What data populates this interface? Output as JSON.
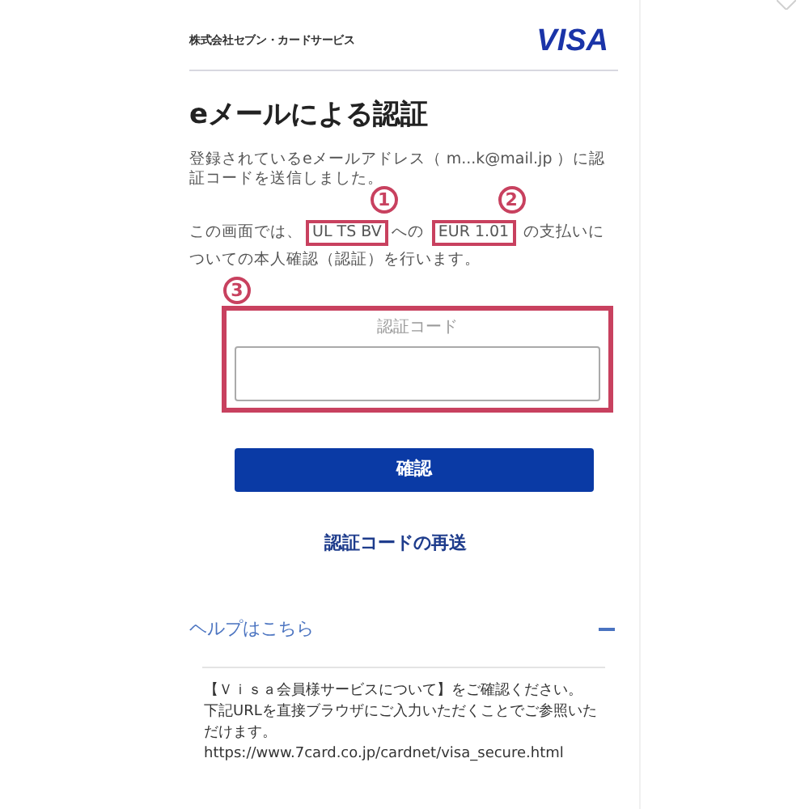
{
  "header": {
    "issuer": "株式会社セブン・カードサービス",
    "brand": "VISA"
  },
  "title": "eメールによる認証",
  "sent_notice": "登録されているeメールアドレス（ m...k@mail.jp ）に認証コードを送信しました。",
  "payment_notice": [
    {
      "text": "この画面では、"
    },
    {
      "text": "UL TS BV",
      "callout": "1"
    },
    {
      "text": "への "
    },
    {
      "text": "EUR 1.01",
      "callout": "2"
    },
    {
      "text": " の支払いについての本人確認（認証）を行います。"
    }
  ],
  "code_field": {
    "label": "認証コード",
    "callout": "3"
  },
  "confirm_button": "確認",
  "resend_link": "認証コードの再送",
  "help": {
    "label": "ヘルプはこちら",
    "expanded": true,
    "lines": [
      "【Ｖｉｓａ会員様サービスについて】をご確認ください。",
      "下記URLを直接ブラウザにご入力いただくことでご参照いただけます。",
      "https://www.7card.co.jp/cardnet/visa_secure.html"
    ]
  }
}
